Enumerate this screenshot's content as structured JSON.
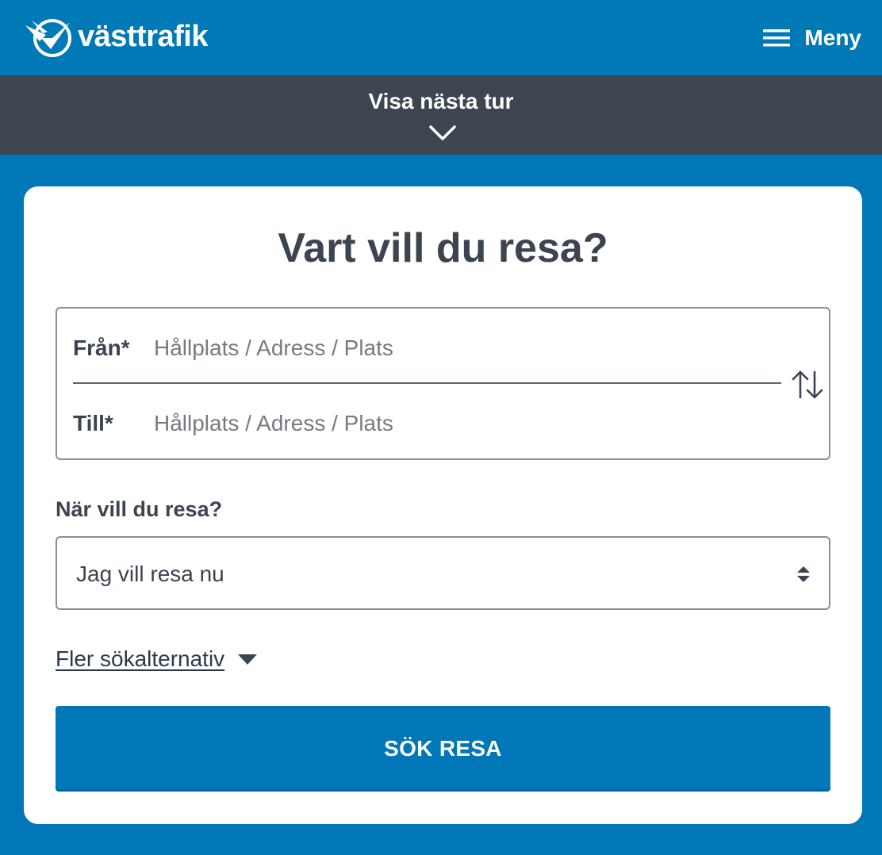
{
  "header": {
    "logo_text": "västtrafik",
    "logo_icon": "vasttrafik-bird-logo",
    "menu_label": "Meny",
    "menu_icon": "hamburger-icon",
    "bg_color": "#0079b7"
  },
  "next_trip_bar": {
    "label": "Visa nästa tur",
    "icon": "chevron-down-icon",
    "bg_color": "#3c4550"
  },
  "search_card": {
    "title": "Vart vill du resa?",
    "from": {
      "label": "Från*",
      "placeholder": "Hållplats / Adress / Plats",
      "value": ""
    },
    "to": {
      "label": "Till*",
      "placeholder": "Hållplats / Adress / Plats",
      "value": ""
    },
    "swap_icon": "swap-arrows-icon",
    "when_label": "När vill du resa?",
    "when_value": "Jag vill resa nu",
    "more_options_label": "Fler sökalternativ",
    "search_button_label": "SÖK RESA",
    "accent_color": "#0077b6"
  }
}
